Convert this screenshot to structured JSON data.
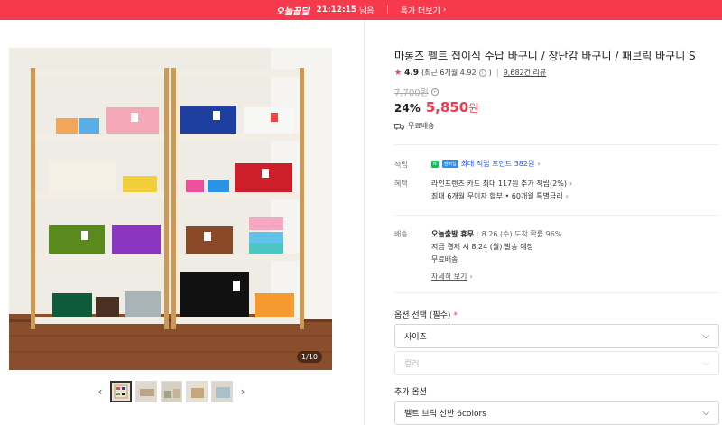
{
  "promo": {
    "logo": "오늘끝딜",
    "timer": "21:12:15",
    "timer_suffix": "남음",
    "link_label": "특가 더보기",
    "color": "#f7394d"
  },
  "gallery": {
    "counter": "1/10",
    "thumbnails": [
      "thumb-1",
      "thumb-2",
      "thumb-3",
      "thumb-4",
      "thumb-5"
    ],
    "active_index": 0
  },
  "product": {
    "title": "마롱즈 펠트 접이식 수납 바구니 / 장난감 바구니 / 패브릭 바구니 S",
    "rating": "4.9",
    "rating_recent": "(최근 6개월 4.92",
    "rating_recent_close": ")",
    "review_count": "9,682건 리뷰",
    "original_price": "7,700원",
    "discount": "24%",
    "price": "5,850",
    "price_unit": "원",
    "shipping_tag": "무료배송"
  },
  "info": {
    "points_label": "적립",
    "points_badge_n": "N",
    "points_badge_pay": "멤버십",
    "points_text": "최대 적립 포인트 382원",
    "benefit_label": "혜택",
    "benefit_line1": "라인프렌즈 카드 최대 117원 추가 적립(2%)",
    "benefit_line2": "최대 6개월 무이자 할부 • 60개월 특별금리",
    "delivery_label": "배송",
    "delivery_service": "오늘출발 휴무",
    "delivery_arrival": "8.26 (수) 도착 확률 96%",
    "delivery_dispatch": "지금 결제 시 8.24 (월) 발송 예정",
    "delivery_fee": "무료배송",
    "delivery_detail_link": "자세히 보기"
  },
  "options": {
    "title": "옵션 선택 (필수)",
    "required_mark": "*",
    "size_select": "사이즈",
    "color_select": "컬러",
    "extra_title": "추가 옵션",
    "extra_select": "펠트 브릭 선반 6colors"
  }
}
